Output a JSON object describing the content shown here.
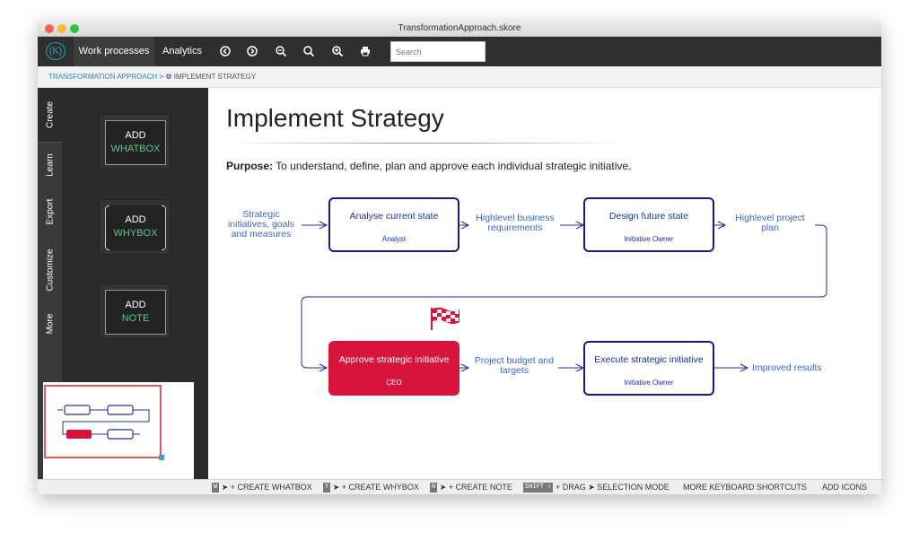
{
  "window": {
    "title": "TransformationApproach.skore"
  },
  "toolbar": {
    "menus": [
      "Work processes",
      "Analytics"
    ],
    "logo": "(K)",
    "icons": [
      "arrow-left-icon",
      "arrow-right-icon",
      "zoom-out-icon",
      "zoom-reset-icon",
      "zoom-in-icon",
      "print-icon"
    ],
    "search_placeholder": "Search"
  },
  "breadcrumb": {
    "root": "TRANSFORMATION APPROACH",
    "separator": ">",
    "current": "IMPLEMENT STRATEGY"
  },
  "sidebar": {
    "tabs": [
      "Create",
      "Learn",
      "Export",
      "Customize",
      "More"
    ],
    "add_whatbox": {
      "line1": "ADD",
      "line2": "WHATBOX"
    },
    "add_whybox": {
      "line1": "ADD",
      "line2": "WHYBOX"
    },
    "add_note": {
      "line1": "ADD",
      "line2": "NOTE"
    }
  },
  "canvas": {
    "title": "Implement Strategy",
    "purpose_label": "Purpose:",
    "purpose_text": "To understand, define, plan and approve each individual strategic initiative.",
    "inputs": [
      "Strategic initiatives, goals and measures",
      "Highlevel business requirements",
      "Highlevel project plan",
      "Project budget and targets",
      "Improved results"
    ],
    "whatboxes": [
      {
        "title": "Analyse current state",
        "role": "Analyst"
      },
      {
        "title": "Design future state",
        "role": "Initiative Owner"
      },
      {
        "title": "Approve strategic initiative",
        "role": "CEO"
      },
      {
        "title": "Execute strategic initiative",
        "role": "Initiative Owner"
      }
    ]
  },
  "statusbar": {
    "items": [
      {
        "key": "W",
        "text": "+ CREATE WHATBOX"
      },
      {
        "key": "Y",
        "text": "+ CREATE WHYBOX"
      },
      {
        "key": "N",
        "text": "+ CREATE NOTE"
      },
      {
        "key": "SHIFT ⇧",
        "text": "+ DRAG",
        "text2": "SELECTION MODE"
      }
    ],
    "more_shortcuts": "MORE KEYBOARD SHORTCUTS",
    "add_icons": "ADD ICONS"
  },
  "colors": {
    "accent_blue": "#1b1b7d",
    "approve_red": "#d7153a",
    "green": "#59c98c",
    "link_blue": "#2a8bb8"
  }
}
